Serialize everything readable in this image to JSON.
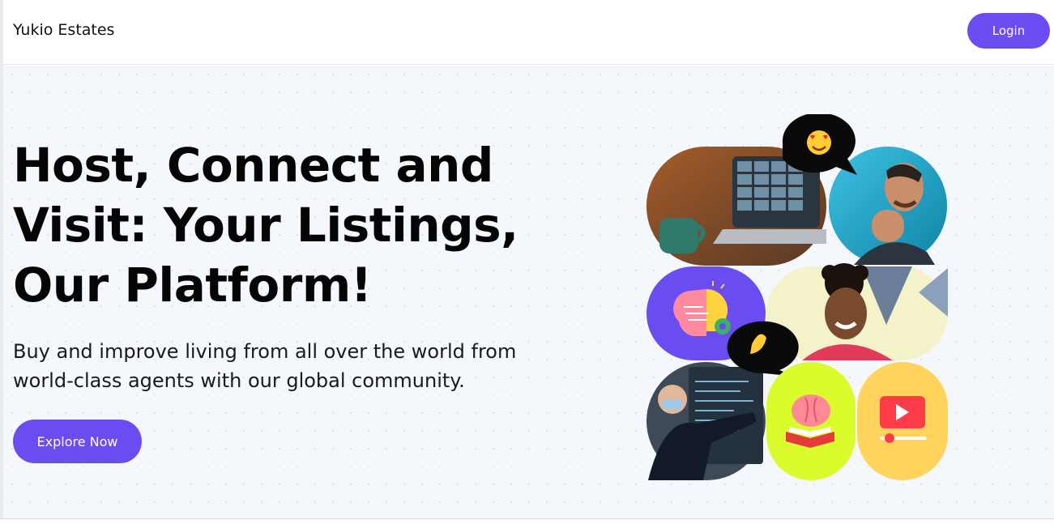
{
  "navbar": {
    "brand": "Yukio Estates",
    "login_label": "Login"
  },
  "hero": {
    "headline": "Host, Connect and Visit: Your Listings, Our Platform!",
    "subtext": "Buy and improve living from all over the world from world-class agents with our global community.",
    "cta_label": "Explore Now"
  },
  "collage": {
    "tiles": [
      {
        "icon": "laptop-video-call-photo"
      },
      {
        "icon": "smiling-man-photo"
      },
      {
        "icon": "brain-lightbulb-icon"
      },
      {
        "icon": "smiling-woman-photo"
      },
      {
        "icon": "teacher-whiteboard-photo"
      },
      {
        "icon": "brain-book-icon"
      },
      {
        "icon": "video-play-icon"
      }
    ],
    "bubbles": [
      {
        "icon": "heart-eyes-emoji"
      },
      {
        "icon": "pinching-hand-emoji"
      }
    ]
  },
  "colors": {
    "accent": "#6a4cf0",
    "hero_background": "#f4f7fb",
    "tile_purple": "#6a4cf0",
    "tile_lime": "#dcfb2c",
    "tile_yellow": "#ffd35c"
  }
}
